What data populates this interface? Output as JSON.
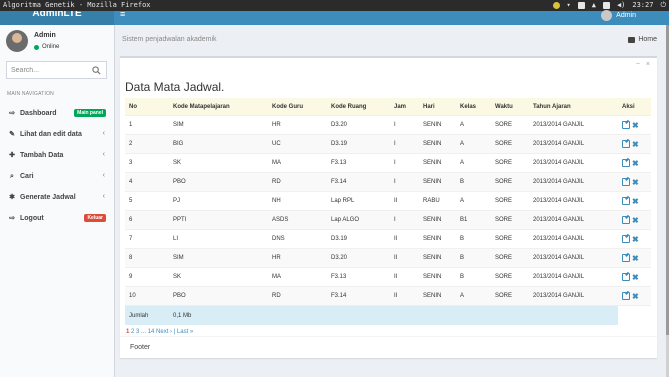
{
  "os_bar": {
    "title": "Algoritma Genetik - Mozilla Firefox",
    "clock": "23:27"
  },
  "header": {
    "logo": "AdminLTE",
    "menu_toggle": "≡",
    "user": "Admin"
  },
  "sidebar": {
    "user_name": "Admin",
    "user_status": "Online",
    "search_placeholder": "Search...",
    "nav_header": "MAIN NAVIGATION",
    "items": [
      {
        "label": "Dashboard",
        "icon": "dashboard-icon",
        "badge": "Main panel"
      },
      {
        "label": "Lihat dan edit data",
        "icon": "edit-icon"
      },
      {
        "label": "Tambah Data",
        "icon": "plus-icon"
      },
      {
        "label": "Cari",
        "icon": "search-icon"
      },
      {
        "label": "Generate Jadwal",
        "icon": "gear-icon"
      },
      {
        "label": "Logout",
        "icon": "logout-icon",
        "badge": "Keluar"
      }
    ]
  },
  "content": {
    "header_text": "Sistem penjadwalan akademik",
    "breadcrumb": "Home"
  },
  "box": {
    "collapse": "−",
    "close": "×",
    "title": "Data Mata Jadwal.",
    "columns": [
      "No",
      "Kode Matapelajaran",
      "Kode Guru",
      "Kode Ruang",
      "Jam",
      "Hari",
      "Kelas",
      "Waktu",
      "Tahun Ajaran",
      "Aksi"
    ],
    "rows": [
      [
        "1",
        "SIM",
        "HR",
        "D3.20",
        "I",
        "SENIN",
        "A",
        "SORE",
        "2013/2014 GANJIL"
      ],
      [
        "2",
        "BIG",
        "UC",
        "D3.19",
        "I",
        "SENIN",
        "A",
        "SORE",
        "2013/2014 GANJIL"
      ],
      [
        "3",
        "SK",
        "MA",
        "F3.13",
        "I",
        "SENIN",
        "A",
        "SORE",
        "2013/2014 GANJIL"
      ],
      [
        "4",
        "PBO",
        "RD",
        "F3.14",
        "I",
        "SENIN",
        "B",
        "SORE",
        "2013/2014 GANJIL"
      ],
      [
        "5",
        "PJ",
        "NH",
        "Lap RPL",
        "II",
        "RABU",
        "A",
        "SORE",
        "2013/2014 GANJIL"
      ],
      [
        "6",
        "PPTI",
        "ASDS",
        "Lap ALGO",
        "I",
        "SENIN",
        "B1",
        "SORE",
        "2013/2014 GANJIL"
      ],
      [
        "7",
        "LI",
        "DNS",
        "D3.19",
        "II",
        "SENIN",
        "B",
        "SORE",
        "2013/2014 GANJIL"
      ],
      [
        "8",
        "SIM",
        "HR",
        "D3.20",
        "II",
        "SENIN",
        "B",
        "SORE",
        "2013/2014 GANJIL"
      ],
      [
        "9",
        "SK",
        "MA",
        "F3.13",
        "II",
        "SENIN",
        "B",
        "SORE",
        "2013/2014 GANJIL"
      ],
      [
        "10",
        "PBO",
        "RD",
        "F3.14",
        "II",
        "SENIN",
        "A",
        "SORE",
        "2013/2014 GANJIL"
      ]
    ],
    "summary": {
      "label": "Jumlah",
      "value": "0,1 Mb"
    },
    "pagination": {
      "current": "1",
      "others": "2 3 ... 14 Next › | Last »"
    },
    "footer": "Footer"
  },
  "colors": {
    "primary": "#3c8dbc",
    "primary_dark": "#367fa9",
    "online": "#00a65a",
    "danger": "#dd4b39"
  }
}
